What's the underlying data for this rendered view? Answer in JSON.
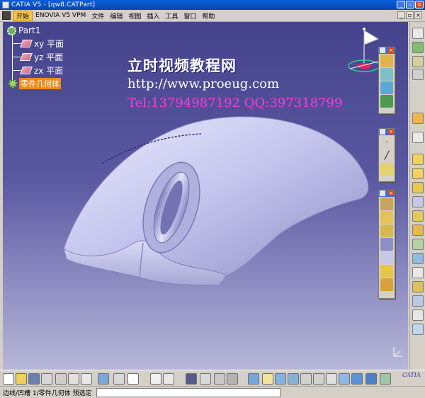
{
  "window": {
    "title": "CATIA V5 - [qw8.CATPart]"
  },
  "menu": {
    "items": [
      "开始",
      "ENOVIA V5 VPM",
      "文件",
      "编辑",
      "视图",
      "插入",
      "工具",
      "窗口",
      "帮助"
    ]
  },
  "tree": {
    "root": "Part1",
    "children": [
      "xy 平面",
      "yz 平面",
      "zx 平面",
      "零件几何体"
    ]
  },
  "watermark": {
    "line1": "立时视频教程网",
    "line2": "http://www.proeug.com",
    "line3": "Tel:13794987192  QQ:397318799"
  },
  "status_bar": {
    "text": "边线/凹槽 1/零件几何体  预选定"
  },
  "brand": {
    "logo_text": "CATIA"
  },
  "colors": {
    "viewport_top": "#45438c",
    "viewport_bottom": "#b7b7d8",
    "model": "#c9c9ee",
    "selection": "#f18a18",
    "watermark_accent": "#ff3ad6"
  }
}
